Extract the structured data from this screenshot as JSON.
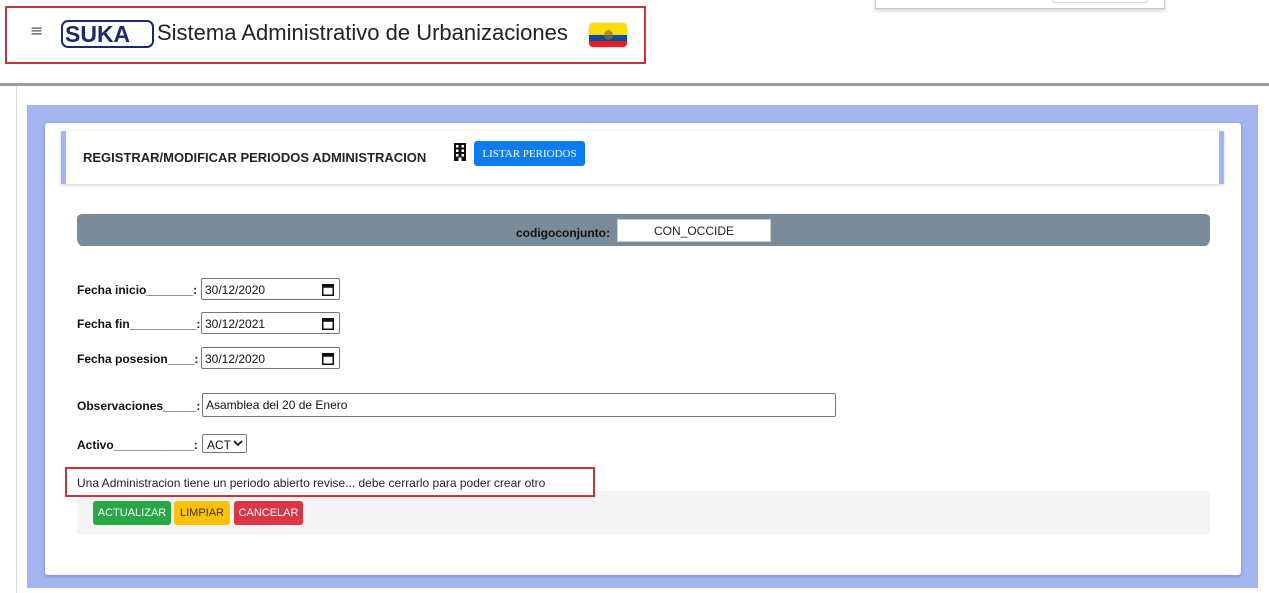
{
  "header": {
    "menu_icon": "hamburger-icon",
    "logo_text": "SUKA",
    "title": "Sistema Administrativo de Urbanizaciones",
    "flag_icon": "ecuador-flag-icon"
  },
  "card": {
    "title": "REGISTRAR/MODIFICAR PERIODOS ADMINISTRACION",
    "title_icon": "building-icon",
    "list_button": "LISTAR PERIODOS"
  },
  "code": {
    "label": "codigoconjunto:",
    "value": "CON_OCCIDE"
  },
  "form": {
    "fecha_inicio_label": "Fecha inicio_______:",
    "fecha_inicio_value": "30/12/2020",
    "fecha_fin_label": "Fecha fin__________:",
    "fecha_fin_value": "30/12/2021",
    "fecha_posesion_label": "Fecha posesion____:",
    "fecha_posesion_value": "30/12/2020",
    "observaciones_label": "Observaciones_____:",
    "observaciones_value": "Asamblea del 20 de Enero",
    "activo_label": "Activo____________:",
    "activo_value": "ACT",
    "calendar_icon": "calendar-icon"
  },
  "alert": {
    "text": "Una Administracion tiene un periodo abierto revise... debe cerrarlo para poder crear otro"
  },
  "buttons": {
    "update": "ACTUALIZAR",
    "clear": "LIMPIAR",
    "cancel": "CANCELAR"
  },
  "colors": {
    "frame": "#a2b5ef",
    "primary": "#0d7cf2",
    "success": "#28a745",
    "warning": "#ffc107",
    "danger": "#dc3545",
    "highlight": "#c9333a",
    "code_bar": "#798a99"
  }
}
